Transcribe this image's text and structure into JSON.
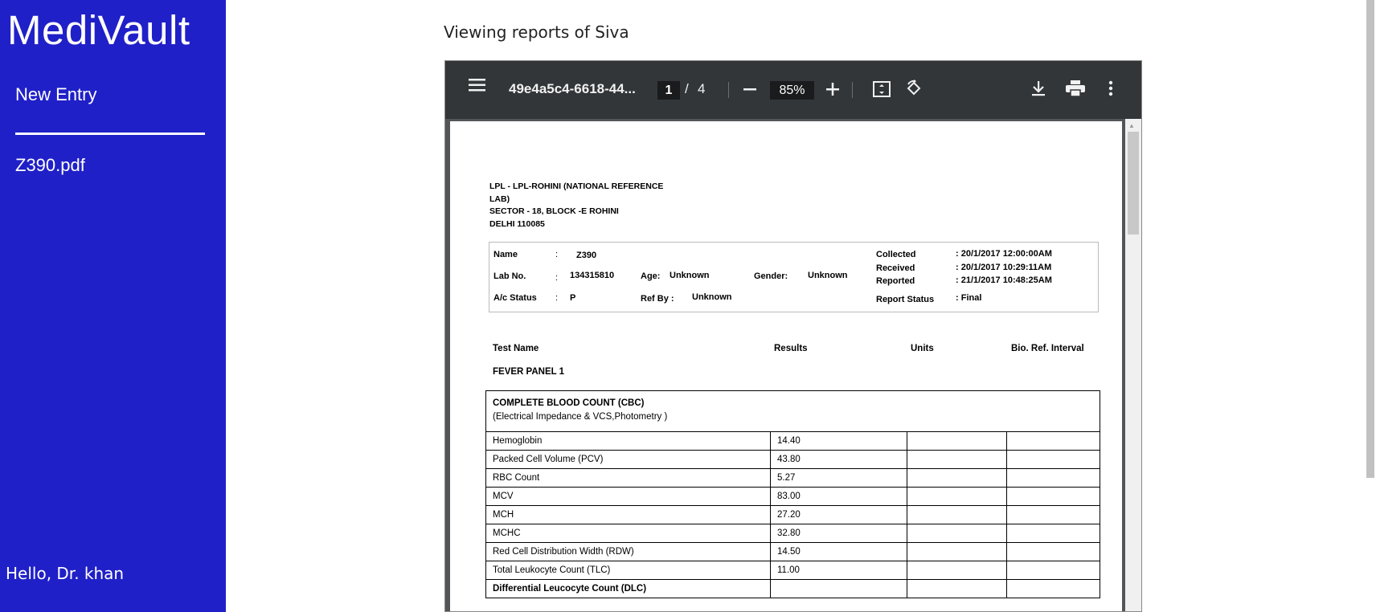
{
  "sidebar": {
    "brand": "MediVault",
    "new_entry": "New Entry",
    "files": [
      "Z390.pdf"
    ],
    "greeting": "Hello, Dr. khan"
  },
  "main": {
    "heading": "Viewing reports of Siva"
  },
  "viewer": {
    "file_title": "49e4a5c4-6618-44...",
    "page_current": "1",
    "page_sep": "/",
    "page_total": "4",
    "zoom": "85%"
  },
  "report": {
    "lab_lines": [
      "LPL - LPL-ROHINI (NATIONAL REFERENCE",
      "LAB)",
      "SECTOR - 18, BLOCK -E ROHINI",
      "DELHI 110085"
    ],
    "labels": {
      "name": "Name",
      "lab_no": "Lab No.",
      "ac_status": "A/c Status",
      "age": "Age:",
      "gender": "Gender:",
      "ref_by": "Ref By :",
      "collected": "Collected",
      "received": "Received",
      "reported": "Reported",
      "report_status": "Report Status",
      "colon": ":"
    },
    "values": {
      "name": "Z390",
      "lab_no": "134315810",
      "ac_status": "P",
      "age": "Unknown",
      "gender": "Unknown",
      "ref_by": "Unknown",
      "collected": ": 20/1/2017  12:00:00AM",
      "received": ": 20/1/2017  10:29:11AM",
      "reported": ": 21/1/2017  10:48:25AM",
      "report_status": ": Final"
    },
    "columns": {
      "test_name": "Test Name",
      "results": "Results",
      "units": "Units",
      "bio_ref": "Bio. Ref. Interval"
    },
    "panel": "FEVER  PANEL 1",
    "cbc_title": "COMPLETE BLOOD COUNT (CBC)",
    "cbc_method": "(Electrical Impedance & VCS,Photometry )",
    "rows": [
      {
        "test": "Hemoglobin",
        "result": "14.40"
      },
      {
        "test": "Packed Cell Volume (PCV)",
        "result": "43.80"
      },
      {
        "test": "RBC Count",
        "result": "5.27"
      },
      {
        "test": "MCV",
        "result": "83.00"
      },
      {
        "test": "MCH",
        "result": "27.20"
      },
      {
        "test": "MCHC",
        "result": "32.80"
      },
      {
        "test": "Red Cell Distribution Width (RDW)",
        "result": "14.50"
      },
      {
        "test": "Total Leukocyte Count  (TLC)",
        "result": "11.00"
      },
      {
        "test": "Differential Leucocyte Count (DLC)",
        "result": ""
      }
    ]
  }
}
